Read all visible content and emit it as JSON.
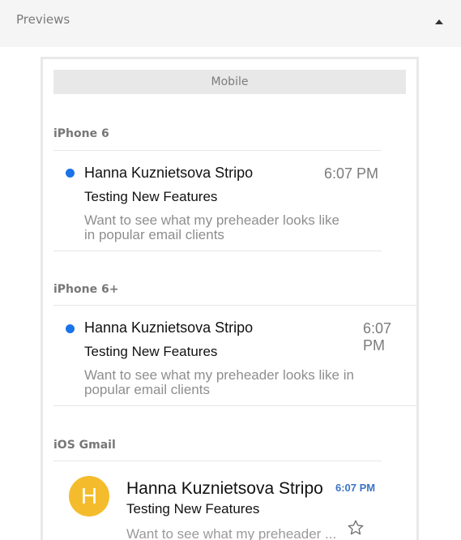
{
  "header": {
    "title": "Previews",
    "toggle_icon": "caret-up-icon"
  },
  "tabs": {
    "mobile_label": "Mobile"
  },
  "previews": [
    {
      "client": "iPhone 6",
      "sender": "Hanna Kuznietsova Stripo",
      "time": "6:07 PM",
      "subject": "Testing New Features",
      "preview_line1": "Want to see what my preheader looks like",
      "preview_line2": "in popular email clients",
      "unread_color": "#1a73e8"
    },
    {
      "client": "iPhone 6+",
      "sender": "Hanna Kuznietsova Stripo",
      "time": "6:07 PM",
      "subject": "Testing New Features",
      "preview_line1": "Want to see what my preheader looks like in",
      "preview_line2": "popular email clients",
      "unread_color": "#1a73e8"
    },
    {
      "client": "iOS Gmail",
      "avatar_letter": "H",
      "avatar_color": "#f4bc2c",
      "sender": "Hanna Kuznietsova Stripo",
      "time": "6:07 PM",
      "subject": "Testing New Features",
      "preview": "Want to see what my preheader ...",
      "star_icon": "star-outline-icon"
    }
  ]
}
